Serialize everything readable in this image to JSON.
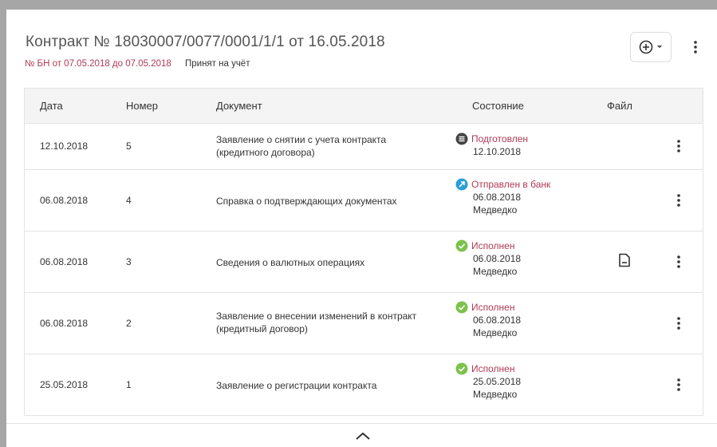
{
  "header": {
    "title": "Контракт № 18030007/0077/0001/1/1 от 16.05.2018",
    "bn_text": "№ БН от 07.05.2018 до 07.05.2018",
    "status_text": "Принят на учёт",
    "add_button_icon": "plus-circle-icon",
    "menu_icon": "more-vertical-icon"
  },
  "table": {
    "columns": [
      "Дата",
      "Номер",
      "Документ",
      "Состояние",
      "Файл"
    ],
    "rows": [
      {
        "date": "12.10.2018",
        "number": "5",
        "document_line1": "Заявление о снятии с учета контракта",
        "document_line2": "(кредитного договора)",
        "state_icon": "list-icon",
        "state": "Подготовлен",
        "state_line1": "12.10.2018",
        "state_line2": "",
        "has_file": false
      },
      {
        "date": "06.08.2018",
        "number": "4",
        "document_line1": "Справка о подтверждающих документах",
        "document_line2": "",
        "state_icon": "sent-arrow-icon",
        "state": "Отправлен в банк",
        "state_line1": "06.08.2018",
        "state_line2": "Медведко",
        "has_file": false
      },
      {
        "date": "06.08.2018",
        "number": "3",
        "document_line1": "Сведения о валютных операциях",
        "document_line2": "",
        "state_icon": "check-circle-icon",
        "state": "Исполнен",
        "state_line1": "06.08.2018",
        "state_line2": "Медведко",
        "has_file": true
      },
      {
        "date": "06.08.2018",
        "number": "2",
        "document_line1": "Заявление о внесении изменений в контракт",
        "document_line2": "(кредитный договор)",
        "state_icon": "check-circle-icon",
        "state": "Исполнен",
        "state_line1": "06.08.2018",
        "state_line2": "Медведко",
        "has_file": false
      },
      {
        "date": "25.05.2018",
        "number": "1",
        "document_line1": "Заявление о регистрации контракта",
        "document_line2": "",
        "state_icon": "check-circle-icon",
        "state": "Исполнен",
        "state_line1": "25.05.2018",
        "state_line2": "Медведко",
        "has_file": false
      }
    ]
  },
  "colors": {
    "accent_red": "#b03a55",
    "status_prepared": "#444444",
    "status_sent": "#2a9fd8",
    "status_done": "#7cc24c",
    "state_text": "#b03a55"
  },
  "footer": {
    "collapse_icon": "chevron-up-icon"
  }
}
